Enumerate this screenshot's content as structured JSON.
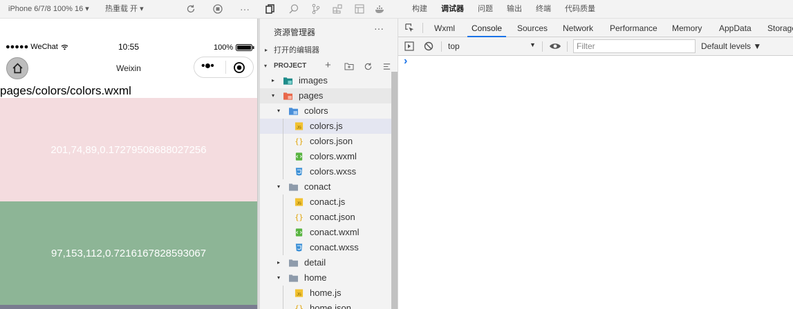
{
  "topbar": {
    "device": "iPhone 6/7/8 100% 16 ▾",
    "hot_reload": "热重载 开 ▾",
    "menu": [
      "构建",
      "调试器",
      "问题",
      "输出",
      "终端",
      "代码质量"
    ],
    "active_menu": "调试器"
  },
  "simulator": {
    "status_signal": "●●●●● WeChat",
    "status_time": "10:55",
    "status_battery": "100%",
    "navbar_title": "Weixin",
    "page_path": "pages/colors/colors.wxml",
    "blocks": [
      {
        "text": "201,74,89,0.17279508688027256",
        "color": "#f4dcdf"
      },
      {
        "text": "97,153,112,0.7216167828593067",
        "color": "#8db596"
      },
      {
        "text": "",
        "color": "#7a7c90"
      }
    ]
  },
  "explorer": {
    "title": "资源管理器",
    "open_editors": "打开的编辑器",
    "project": "PROJECT",
    "tree": [
      {
        "label": "images",
        "depth": 0,
        "kind": "folder-img",
        "caret": "▸"
      },
      {
        "label": "pages",
        "depth": 0,
        "kind": "folder-pages",
        "caret": "▾"
      },
      {
        "label": "colors",
        "depth": 1,
        "kind": "folder-blue",
        "caret": "▾"
      },
      {
        "label": "colors.js",
        "depth": 2,
        "kind": "js",
        "caret": "",
        "selected": true
      },
      {
        "label": "colors.json",
        "depth": 2,
        "kind": "json",
        "caret": ""
      },
      {
        "label": "colors.wxml",
        "depth": 2,
        "kind": "wxml",
        "caret": ""
      },
      {
        "label": "colors.wxss",
        "depth": 2,
        "kind": "wxss",
        "caret": ""
      },
      {
        "label": "conact",
        "depth": 1,
        "kind": "folder",
        "caret": "▾"
      },
      {
        "label": "conact.js",
        "depth": 2,
        "kind": "js",
        "caret": ""
      },
      {
        "label": "conact.json",
        "depth": 2,
        "kind": "json",
        "caret": ""
      },
      {
        "label": "conact.wxml",
        "depth": 2,
        "kind": "wxml",
        "caret": ""
      },
      {
        "label": "conact.wxss",
        "depth": 2,
        "kind": "wxss",
        "caret": ""
      },
      {
        "label": "detail",
        "depth": 1,
        "kind": "folder",
        "caret": "▸"
      },
      {
        "label": "home",
        "depth": 1,
        "kind": "folder",
        "caret": "▾"
      },
      {
        "label": "home.js",
        "depth": 2,
        "kind": "js",
        "caret": ""
      },
      {
        "label": "home.json",
        "depth": 2,
        "kind": "json",
        "caret": ""
      }
    ]
  },
  "devtools": {
    "tabs": [
      "Wxml",
      "Console",
      "Sources",
      "Network",
      "Performance",
      "Memory",
      "AppData",
      "Storage"
    ],
    "active_tab": "Console",
    "context": "top",
    "filter_placeholder": "Filter",
    "levels": "Default levels ▼",
    "prompt": "›"
  },
  "colors": {
    "accent": "#1a73e8",
    "toolbar_bg": "#f3f3f3",
    "selected_row": "#e4e6f1"
  }
}
